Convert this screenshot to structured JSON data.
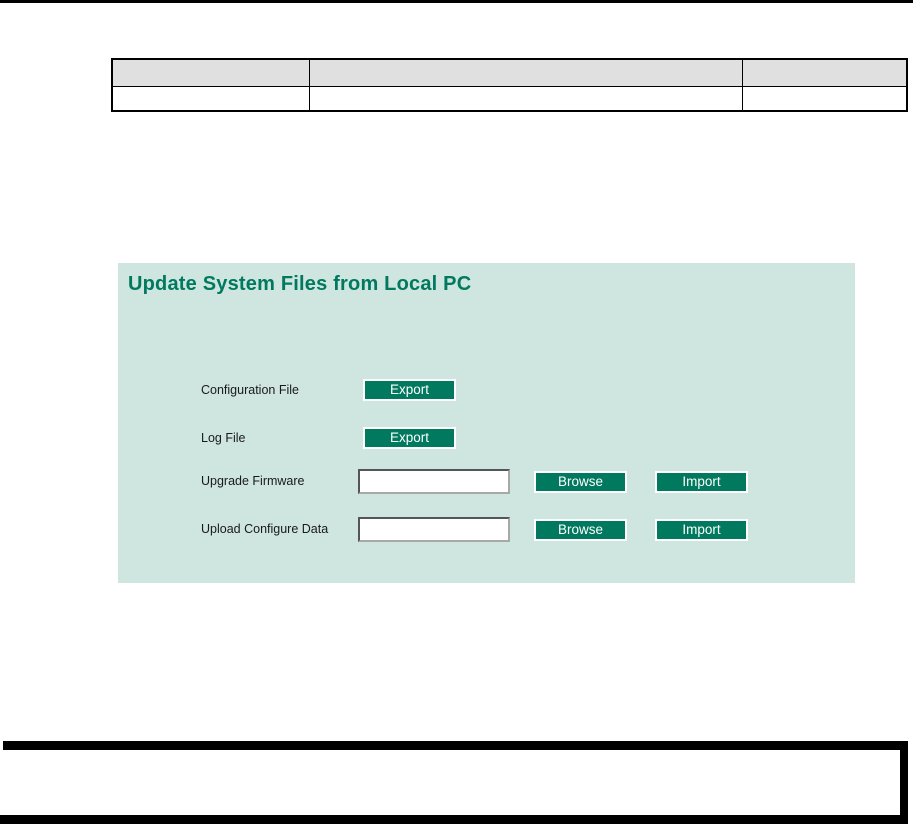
{
  "document": {
    "table": {
      "headers": [
        "",
        "",
        ""
      ],
      "rows": [
        [
          "",
          "",
          ""
        ]
      ]
    }
  },
  "panel": {
    "title": "Update System Files from Local PC",
    "rows": [
      {
        "label": "Configuration File",
        "buttons": [
          "Export"
        ]
      },
      {
        "label": "Log File",
        "buttons": [
          "Export"
        ]
      },
      {
        "label": "Upgrade Firmware",
        "input": {
          "value": "",
          "placeholder": ""
        },
        "buttons": [
          "Browse",
          "Import"
        ]
      },
      {
        "label": "Upload Configure Data",
        "input": {
          "value": "",
          "placeholder": ""
        },
        "buttons": [
          "Browse",
          "Import"
        ]
      }
    ]
  },
  "colors": {
    "accent_green": "#00795f",
    "panel_bg": "#cee5e0",
    "table_header_bg": "#e0e0e0"
  }
}
